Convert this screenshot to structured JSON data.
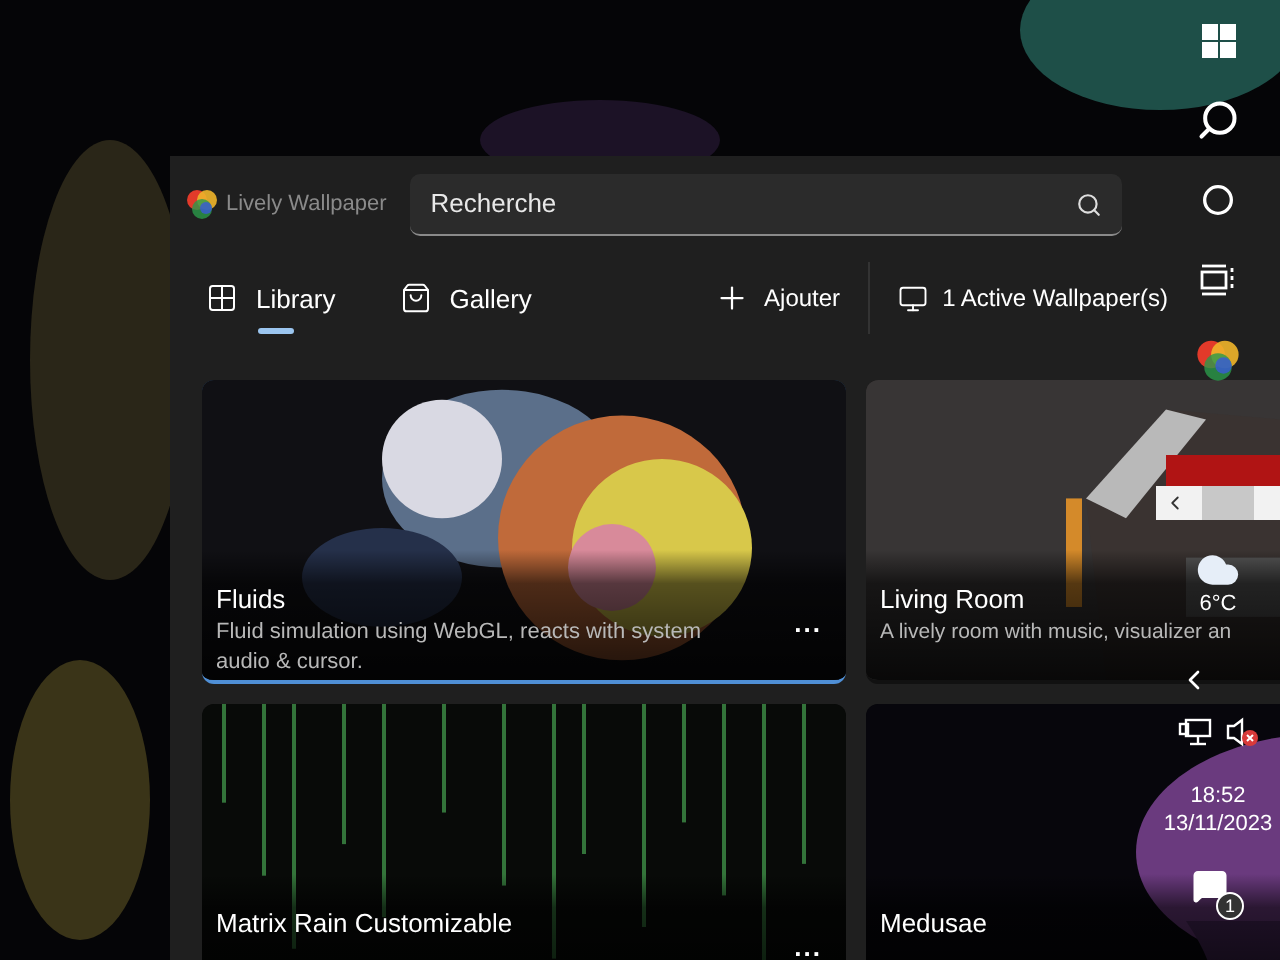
{
  "app": {
    "title": "Lively Wallpaper",
    "search": {
      "placeholder": "Recherche"
    },
    "tabs": [
      {
        "label": "Library",
        "kind": "library",
        "selected": true
      },
      {
        "label": "Gallery",
        "kind": "gallery",
        "selected": false
      }
    ],
    "actions": [
      {
        "label": "Ajouter",
        "kind": "add"
      },
      {
        "label": "1 Active Wallpaper(s)",
        "kind": "monitor"
      }
    ]
  },
  "wallpapers": [
    {
      "title": "Fluids",
      "description": "Fluid simulation using WebGL, reacts with system audio & cursor.",
      "kind": "fluid",
      "selected": true,
      "more": "..."
    },
    {
      "title": "Living Room",
      "description": "A lively room with music, visualizer an",
      "kind": "room",
      "selected": false
    },
    {
      "title": "Matrix Rain Customizable",
      "kind": "matrix",
      "selected": false,
      "more": "..."
    },
    {
      "title": "Medusae",
      "kind": "jelly",
      "selected": false
    }
  ],
  "taskbar": {
    "temperature": "6°C",
    "time": "18:52",
    "date": "13/11/2023",
    "notifications": "1",
    "volume_muted": true
  }
}
